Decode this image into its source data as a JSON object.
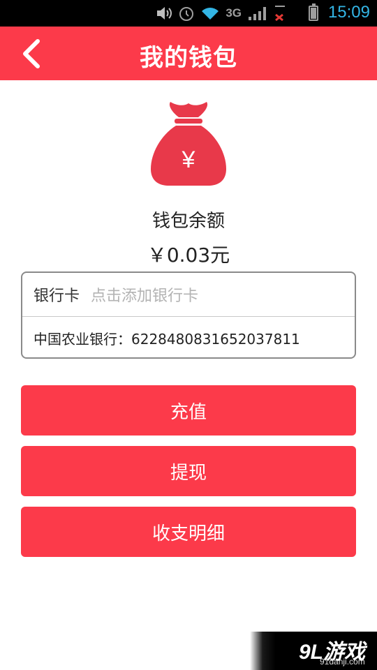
{
  "status_bar": {
    "network": "3G",
    "sim1": "1",
    "sim2": "2",
    "time": "15:09",
    "icons": [
      "volume-icon",
      "alarm-icon",
      "wifi-icon",
      "signal-icon",
      "battery-icon"
    ]
  },
  "header": {
    "title": "我的钱包",
    "back_icon": "chevron-left-icon",
    "background": "#fc3a4a"
  },
  "wallet": {
    "icon": "money-bag-icon",
    "icon_symbol": "¥",
    "balance_label": "钱包余额",
    "balance_value": "￥0.03元"
  },
  "bank": {
    "label": "银行卡",
    "placeholder": "点击添加银行卡",
    "account": "中国农业银行：6228480831652037811"
  },
  "buttons": {
    "recharge": "充值",
    "withdraw": "提现",
    "details": "收支明细"
  },
  "watermark": {
    "logo": "9L游戏",
    "domain": "91danji.com"
  },
  "colors": {
    "accent": "#fc3a4a",
    "status_blue": "#33b5e5"
  }
}
